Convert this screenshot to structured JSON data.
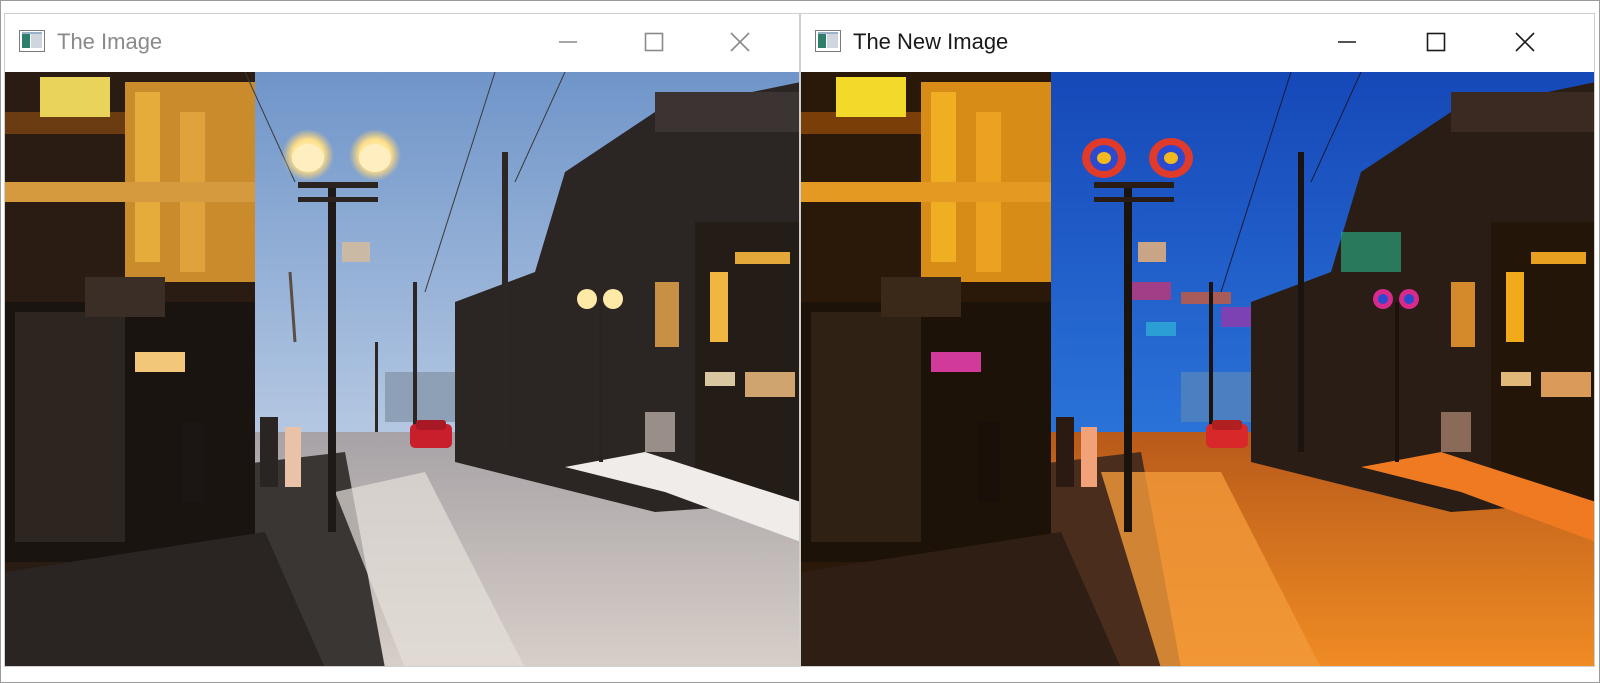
{
  "windows": [
    {
      "title": "The Image",
      "controls": {
        "minimize": "minimize-icon",
        "maximize": "maximize-icon",
        "close": "close-icon"
      },
      "image": {
        "subject": "street-photo",
        "variant": "original"
      }
    },
    {
      "title": "The New Image",
      "controls": {
        "minimize": "minimize-icon",
        "maximize": "maximize-icon",
        "close": "close-icon"
      },
      "image": {
        "subject": "street-photo",
        "variant": "processed"
      }
    }
  ],
  "colors": {
    "inactive_title": "#8a8a8a",
    "active_title": "#1a1a1a",
    "original_sky": "#8fb0d9",
    "processed_sky": "#1d57c9",
    "original_road": "#ccc3bd",
    "processed_road": "#e0761c"
  }
}
